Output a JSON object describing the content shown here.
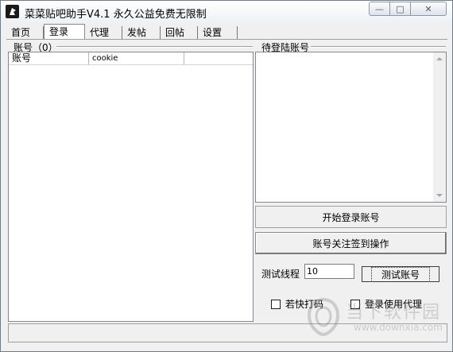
{
  "window": {
    "title": "菜菜贴吧助手V4.1  永久公益免费无限制",
    "minimize_glyph": "—",
    "maximize_glyph": "□",
    "close_glyph": "✕"
  },
  "tabs": [
    {
      "label": "首页",
      "active": false
    },
    {
      "label": "登录",
      "active": true
    },
    {
      "label": "代理",
      "active": false
    },
    {
      "label": "发帖",
      "active": false
    },
    {
      "label": "回帖",
      "active": false
    },
    {
      "label": "设置",
      "active": false
    }
  ],
  "accounts": {
    "group_label": "账号（0）",
    "columns": [
      "账号",
      "cookie",
      ""
    ]
  },
  "pending": {
    "group_label": "待登陆账号"
  },
  "actions": {
    "start_login": "开始登录账号",
    "follow_sign": "账号关注签到操作",
    "thread_label": "测试线程",
    "thread_value": "10",
    "test_button": "测试账号",
    "fast_captcha_label": "若快打码",
    "fast_captcha_checked": false,
    "login_proxy_label": "登录使用代理",
    "login_proxy_checked": false
  },
  "watermark": {
    "brand": "当下软件园",
    "url": "www.downxia.com"
  },
  "icons": {
    "app": "app-logo-icon",
    "scroll_up": "chevron-up-icon",
    "scroll_down": "chevron-down-icon"
  }
}
